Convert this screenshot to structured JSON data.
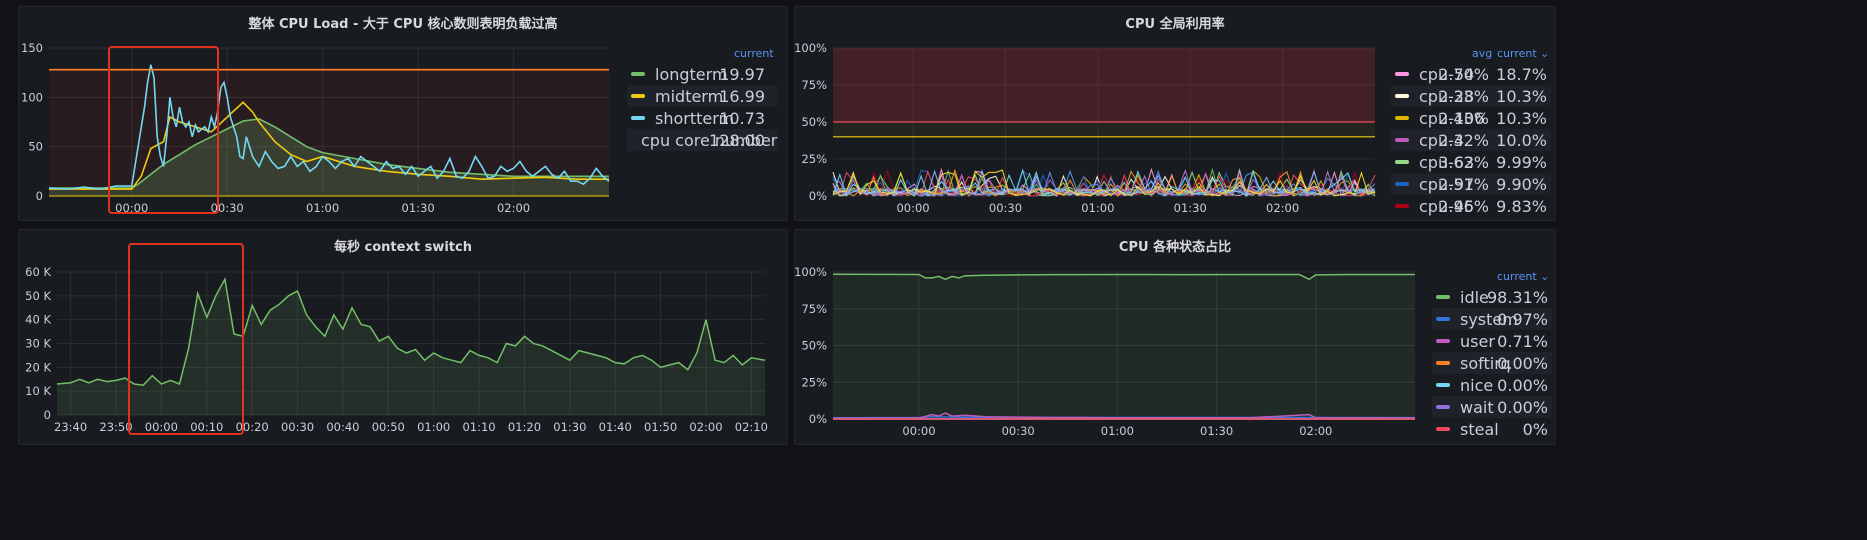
{
  "colors": {
    "green": "#73bf69",
    "yellow": "#f2cc0c",
    "cyan": "#73d9f2",
    "orange": "#ff7f2a",
    "red": "#f2495c",
    "blue": "#3274d9",
    "purple": "#8f3bb8",
    "pink": "#ff96e3",
    "highlight": "#e0321e"
  },
  "panels": {
    "cpu_load": {
      "title": "整体 CPU Load - 大于 CPU 核心数则表明负载过高",
      "legend_header": "current",
      "legend": [
        {
          "name": "longterm",
          "current": "19.97",
          "color": "#73bf69"
        },
        {
          "name": "midterm",
          "current": "16.99",
          "color": "#f2cc0c"
        },
        {
          "name": "shortterm",
          "current": "10.73",
          "color": "#73d9f2"
        },
        {
          "name": "cpu core number",
          "current": "128.00",
          "color": "#ff7f2a"
        }
      ]
    },
    "cpu_util": {
      "title": "CPU 全局利用率",
      "legend_header_avg": "avg",
      "legend_header_current": "current ⌄",
      "legend": [
        {
          "name": "cpu-54",
          "avg": "2.70%",
          "current": "18.7%",
          "color": "#ff96e3"
        },
        {
          "name": "cpu-28",
          "avg": "2.33%",
          "current": "10.3%",
          "color": "#fff8dc"
        },
        {
          "name": "cpu-106",
          "avg": "2.43%",
          "current": "10.3%",
          "color": "#e0b400"
        },
        {
          "name": "cpu-4",
          "avg": "2.32%",
          "current": "10.0%",
          "color": "#c15cbd"
        },
        {
          "name": "cpu-63",
          "avg": "3.62%",
          "current": "9.99%",
          "color": "#96d98d"
        },
        {
          "name": "cpu-97",
          "avg": "2.51%",
          "current": "9.90%",
          "color": "#1f60c4"
        },
        {
          "name": "cpu-45",
          "avg": "2.96%",
          "current": "9.83%",
          "color": "#ad0317"
        }
      ]
    },
    "ctx_switch": {
      "title": "每秒 context switch"
    },
    "cpu_states": {
      "title": "CPU 各种状态占比",
      "legend_header": "current ⌄",
      "legend": [
        {
          "name": "idle",
          "current": "98.31%",
          "color": "#73bf69"
        },
        {
          "name": "system",
          "current": "0.97%",
          "color": "#3274d9"
        },
        {
          "name": "user",
          "current": "0.71%",
          "color": "#c15cbd"
        },
        {
          "name": "softirq",
          "current": "0.00%",
          "color": "#ff7f2a"
        },
        {
          "name": "nice",
          "current": "0.00%",
          "color": "#73d9f2"
        },
        {
          "name": "wait",
          "current": "0.00%",
          "color": "#8f6fd9"
        },
        {
          "name": "steal",
          "current": "0%",
          "color": "#f2495c"
        }
      ]
    }
  },
  "chart_data": [
    {
      "type": "line",
      "title": "整体 CPU Load - 大于 CPU 核心数则表明负载过高",
      "ylim": [
        0,
        150
      ],
      "yticks": [
        "0",
        "50",
        "100",
        "150"
      ],
      "xticks": [
        "00:00",
        "00:30",
        "01:00",
        "01:30",
        "02:00"
      ],
      "xrange_min": [
        -26,
        150
      ],
      "xtick_min": [
        0,
        30,
        60,
        90,
        120
      ],
      "threshold": {
        "name": "cpu core number",
        "value": 128
      },
      "series": [
        {
          "name": "longterm",
          "x": [
            -26,
            -10,
            0,
            2,
            6,
            10,
            15,
            20,
            25,
            30,
            35,
            40,
            45,
            50,
            55,
            60,
            70,
            80,
            90,
            100,
            110,
            120,
            130,
            140,
            150
          ],
          "y": [
            8,
            8,
            8,
            12,
            22,
            32,
            42,
            52,
            60,
            68,
            76,
            78,
            70,
            60,
            50,
            44,
            38,
            32,
            28,
            24,
            22,
            20,
            20,
            20,
            20
          ]
        },
        {
          "name": "midterm",
          "x": [
            -26,
            -10,
            0,
            3,
            6,
            10,
            12,
            15,
            20,
            25,
            30,
            35,
            38,
            40,
            45,
            50,
            55,
            60,
            70,
            80,
            90,
            100,
            110,
            120,
            130,
            140,
            150
          ],
          "y": [
            7,
            7,
            7,
            20,
            48,
            55,
            80,
            75,
            70,
            65,
            80,
            95,
            85,
            75,
            55,
            42,
            35,
            40,
            30,
            25,
            22,
            20,
            17,
            18,
            19,
            17,
            17
          ]
        },
        {
          "name": "shortterm",
          "x": [
            -26,
            -20,
            -15,
            -10,
            -5,
            0,
            2,
            4,
            5,
            6,
            7,
            8,
            9,
            10,
            11,
            12,
            13,
            14,
            15,
            16,
            17,
            18,
            19,
            20,
            21,
            22,
            23,
            24,
            25,
            26,
            27,
            28,
            29,
            30,
            31,
            32,
            33,
            34,
            35,
            36,
            38,
            40,
            42,
            44,
            46,
            48,
            50,
            52,
            54,
            56,
            58,
            60,
            62,
            64,
            66,
            68,
            70,
            72,
            74,
            76,
            78,
            80,
            82,
            84,
            86,
            88,
            90,
            92,
            94,
            96,
            98,
            100,
            102,
            104,
            106,
            108,
            110,
            112,
            114,
            116,
            118,
            120,
            122,
            124,
            126,
            128,
            130,
            132,
            134,
            136,
            138,
            140,
            142,
            144,
            146,
            148,
            150
          ],
          "y": [
            8,
            7,
            9,
            7,
            10,
            10,
            50,
            90,
            115,
            133,
            120,
            60,
            40,
            30,
            60,
            100,
            80,
            70,
            90,
            75,
            70,
            75,
            60,
            72,
            65,
            68,
            70,
            65,
            80,
            70,
            85,
            110,
            115,
            100,
            80,
            70,
            60,
            40,
            38,
            60,
            40,
            30,
            45,
            35,
            28,
            30,
            40,
            30,
            35,
            25,
            30,
            40,
            35,
            28,
            35,
            38,
            30,
            40,
            35,
            30,
            25,
            35,
            28,
            30,
            22,
            30,
            20,
            25,
            30,
            18,
            25,
            38,
            20,
            18,
            25,
            40,
            30,
            18,
            20,
            30,
            25,
            28,
            35,
            25,
            20,
            25,
            30,
            22,
            18,
            25,
            15,
            15,
            12,
            18,
            28,
            20,
            15
          ]
        },
        {
          "name": "cpu core number",
          "x": [
            -26,
            150
          ],
          "y": [
            128,
            128
          ]
        }
      ]
    },
    {
      "type": "line",
      "title": "CPU 全局利用率",
      "ylim": [
        0,
        100
      ],
      "yticks": [
        "0%",
        "25%",
        "50%",
        "75%",
        "100%"
      ],
      "xticks": [
        "00:00",
        "00:30",
        "01:00",
        "01:30",
        "02:00"
      ],
      "thresholds": [
        {
          "value": 50,
          "color": "#f2495c"
        },
        {
          "value": 40,
          "color": "#f2cc0c"
        }
      ],
      "series_note_visible": "many cpu-N series",
      "series": [
        {
          "name": "cpu-54"
        },
        {
          "name": "cpu-28"
        },
        {
          "name": "cpu-106"
        },
        {
          "name": "cpu-4"
        },
        {
          "name": "cpu-63"
        },
        {
          "name": "cpu-97"
        },
        {
          "name": "cpu-45"
        }
      ]
    },
    {
      "type": "area",
      "title": "每秒 context switch",
      "ylim": [
        0,
        60000
      ],
      "yticks": [
        "0",
        "10 K",
        "20 K",
        "30 K",
        "40 K",
        "50 K",
        "60 K"
      ],
      "xticks": [
        "23:40",
        "23:50",
        "00:00",
        "00:10",
        "00:20",
        "00:30",
        "00:40",
        "00:50",
        "01:00",
        "01:10",
        "01:20",
        "01:30",
        "01:40",
        "01:50",
        "02:00",
        "02:10"
      ],
      "xrange_min": [
        -23,
        133
      ],
      "xtick_min": [
        -20,
        -10,
        0,
        10,
        20,
        30,
        40,
        50,
        60,
        70,
        80,
        90,
        100,
        110,
        120,
        130
      ],
      "series": [
        {
          "name": "context switch",
          "x": [
            -23,
            -20,
            -18,
            -16,
            -14,
            -12,
            -10,
            -8,
            -6,
            -4,
            -2,
            0,
            2,
            4,
            6,
            8,
            10,
            12,
            14,
            16,
            18,
            20,
            22,
            24,
            26,
            28,
            30,
            32,
            34,
            36,
            38,
            40,
            42,
            44,
            46,
            48,
            50,
            52,
            54,
            56,
            58,
            60,
            62,
            64,
            66,
            68,
            70,
            72,
            74,
            76,
            78,
            80,
            82,
            84,
            86,
            88,
            90,
            92,
            94,
            96,
            98,
            100,
            102,
            104,
            106,
            108,
            110,
            112,
            114,
            116,
            118,
            120,
            122,
            124,
            126,
            128,
            130,
            133
          ],
          "y": [
            13000,
            13500,
            15000,
            13500,
            15000,
            14000,
            14500,
            15500,
            13000,
            12500,
            16500,
            13000,
            14500,
            13000,
            28000,
            51000,
            41000,
            50000,
            57000,
            34000,
            33000,
            46000,
            38000,
            44000,
            46500,
            50000,
            52000,
            42000,
            37000,
            33000,
            42000,
            36000,
            45000,
            38000,
            37000,
            31000,
            33000,
            28000,
            26000,
            27500,
            23000,
            26000,
            24000,
            23000,
            22000,
            27000,
            25000,
            24000,
            22000,
            30000,
            29000,
            33000,
            30000,
            29000,
            27000,
            25000,
            23000,
            27000,
            26000,
            25000,
            24000,
            22000,
            21500,
            24000,
            25000,
            23000,
            20000,
            21000,
            22000,
            19000,
            26000,
            40000,
            23000,
            22000,
            25000,
            21000,
            24000,
            23000
          ]
        }
      ]
    },
    {
      "type": "area",
      "title": "CPU 各种状态占比",
      "ylim": [
        0,
        100
      ],
      "yticks": [
        "0%",
        "25%",
        "50%",
        "75%",
        "100%"
      ],
      "xticks": [
        "00:00",
        "00:30",
        "01:00",
        "01:30",
        "02:00"
      ],
      "xrange_min": [
        -26,
        150
      ],
      "xtick_min": [
        0,
        30,
        60,
        90,
        120
      ],
      "series": [
        {
          "name": "idle",
          "x": [
            -26,
            0,
            2,
            4,
            6,
            8,
            10,
            12,
            14,
            20,
            30,
            40,
            60,
            80,
            100,
            115,
            118,
            120,
            130,
            150
          ],
          "y": [
            98.5,
            98.3,
            96,
            96,
            97,
            95,
            97,
            96,
            97.5,
            97.8,
            98,
            98.2,
            98.3,
            98.2,
            98.3,
            98.3,
            95,
            98,
            98.3,
            98.3
          ]
        },
        {
          "name": "system",
          "x": [
            -26,
            0,
            4,
            10,
            20,
            40,
            60,
            100,
            120,
            150
          ],
          "y": [
            0.9,
            1,
            1.5,
            1.3,
            1.2,
            1.1,
            1,
            1,
            1,
            0.97
          ]
        },
        {
          "name": "user",
          "x": [
            -26,
            0,
            4,
            6,
            8,
            10,
            14,
            20,
            40,
            60,
            100,
            118,
            120,
            150
          ],
          "y": [
            0.5,
            0.6,
            3,
            2,
            4,
            2,
            2.5,
            1.5,
            1,
            0.8,
            0.8,
            3,
            0.8,
            0.71
          ]
        },
        {
          "name": "softirq",
          "x": [
            -26,
            150
          ],
          "y": [
            0.1,
            0.1
          ]
        },
        {
          "name": "nice",
          "x": [
            -26,
            150
          ],
          "y": [
            0,
            0
          ]
        },
        {
          "name": "wait",
          "x": [
            -26,
            150
          ],
          "y": [
            0,
            0
          ]
        },
        {
          "name": "steal",
          "x": [
            -26,
            150
          ],
          "y": [
            0,
            0
          ]
        }
      ]
    }
  ]
}
